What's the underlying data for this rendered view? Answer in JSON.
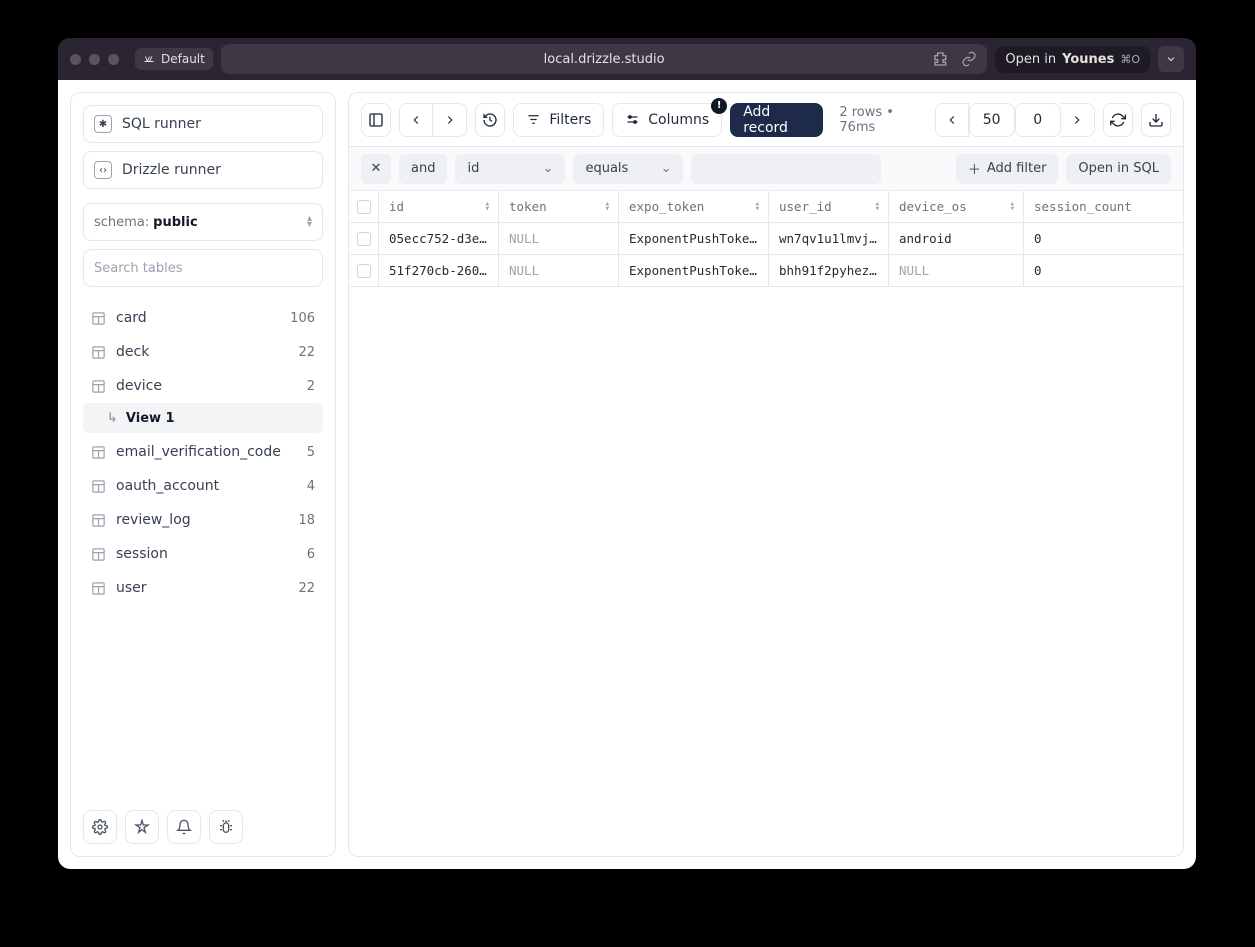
{
  "window": {
    "tag": "Default",
    "address": "local.drizzle.studio",
    "open_in_label": "Open in",
    "open_in_app": "Younes",
    "open_in_kbd": "⌘O"
  },
  "sidebar": {
    "sql_runner": "SQL runner",
    "drizzle_runner": "Drizzle runner",
    "schema_label": "schema:",
    "schema_value": "public",
    "search_placeholder": "Search tables",
    "tables": [
      {
        "name": "card",
        "count": "106"
      },
      {
        "name": "deck",
        "count": "22"
      },
      {
        "name": "device",
        "count": "2",
        "views": [
          {
            "name": "View 1"
          }
        ]
      },
      {
        "name": "email_verification_code",
        "count": "5"
      },
      {
        "name": "oauth_account",
        "count": "4"
      },
      {
        "name": "review_log",
        "count": "18"
      },
      {
        "name": "session",
        "count": "6"
      },
      {
        "name": "user",
        "count": "22"
      }
    ]
  },
  "toolbar": {
    "filters": "Filters",
    "columns": "Columns",
    "columns_badge": "!",
    "add_record": "Add record",
    "status": "2 rows • 76ms",
    "limit": "50",
    "offset": "0"
  },
  "filters": {
    "logic": "and",
    "field": "id",
    "op": "equals",
    "value": "",
    "add": "Add filter",
    "open_sql": "Open in SQL"
  },
  "columns": [
    "id",
    "token",
    "expo_token",
    "user_id",
    "device_os",
    "session_count"
  ],
  "rows": [
    {
      "id": "05ecc752-d3e…",
      "token": "NULL",
      "expo_token": "ExponentPushToke…",
      "user_id": "wn7qv1u1lmvj…",
      "device_os": "android",
      "session_count": "0"
    },
    {
      "id": "51f270cb-260…",
      "token": "NULL",
      "expo_token": "ExponentPushToke…",
      "user_id": "bhh91f2pyhez…",
      "device_os": "NULL",
      "session_count": "0"
    }
  ]
}
